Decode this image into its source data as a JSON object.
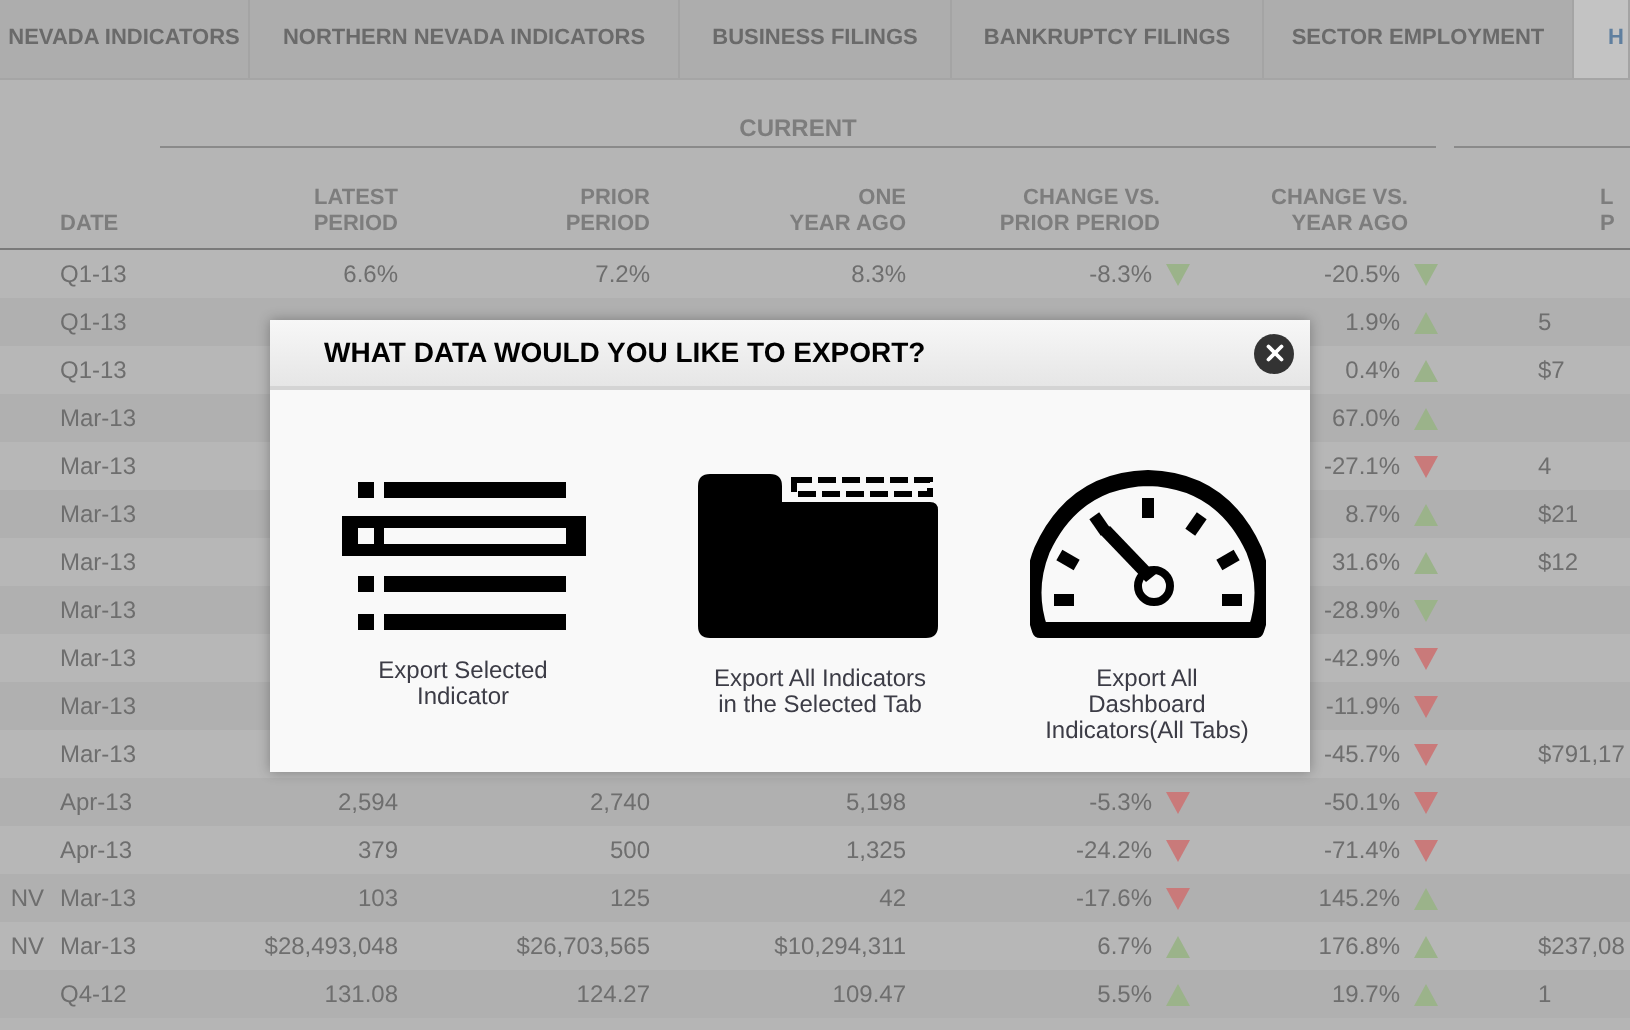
{
  "tabs": [
    {
      "label": "NEVADA INDICATORS",
      "selected": false
    },
    {
      "label": "NORTHERN NEVADA INDICATORS",
      "selected": false
    },
    {
      "label": "BUSINESS FILINGS",
      "selected": false
    },
    {
      "label": "BANKRUPTCY FILINGS",
      "selected": false
    },
    {
      "label": "SECTOR EMPLOYMENT",
      "selected": false
    },
    {
      "label": "H",
      "selected": true
    }
  ],
  "group_header": {
    "label": "CURRENT"
  },
  "columns": {
    "date": [
      "DATE"
    ],
    "latest": [
      "LATEST",
      "PERIOD"
    ],
    "prior": [
      "PRIOR",
      "PERIOD"
    ],
    "one_year_ago": [
      "ONE",
      "YEAR AGO"
    ],
    "change_vs_prior": [
      "CHANGE VS.",
      "PRIOR PERIOD"
    ],
    "change_vs_year": [
      "CHANGE VS.",
      "YEAR AGO"
    ],
    "column_8": [
      "L",
      "P"
    ]
  },
  "rows": [
    {
      "date": "Q1-13",
      "latest": "6.6%",
      "prior": "7.2%",
      "one_year_ago": "8.3%",
      "change_vs_prior": {
        "value": "-8.3%",
        "rising": false,
        "color": "#9bb38a"
      },
      "change_vs_year": {
        "value": "-20.5%",
        "rising": false,
        "color": "#9bb38a"
      }
    },
    {
      "date": "Q1-13",
      "change_vs_year": {
        "value": "1.9%",
        "rising": true,
        "color": "#9bb38a"
      },
      "column_8": "5"
    },
    {
      "date": "Q1-13",
      "change_vs_year": {
        "value": "0.4%",
        "rising": true,
        "color": "#9bb38a"
      },
      "column_8": "$7"
    },
    {
      "date": "Mar-13",
      "change_vs_year": {
        "value": "67.0%",
        "rising": true,
        "color": "#9bb38a"
      }
    },
    {
      "date": "Mar-13",
      "change_vs_year": {
        "value": "-27.1%",
        "rising": false,
        "color": "#c97a7a"
      },
      "column_8": "4"
    },
    {
      "date": "Mar-13",
      "change_vs_year": {
        "value": "8.7%",
        "rising": true,
        "color": "#9bb38a"
      },
      "column_8": "$21"
    },
    {
      "date": "Mar-13",
      "change_vs_year": {
        "value": "31.6%",
        "rising": true,
        "color": "#9bb38a"
      },
      "column_8": "$12"
    },
    {
      "date": "Mar-13",
      "change_vs_year": {
        "value": "-28.9%",
        "rising": false,
        "color": "#9bb38a"
      }
    },
    {
      "date": "Mar-13",
      "change_vs_year": {
        "value": "-42.9%",
        "rising": false,
        "color": "#c97a7a"
      }
    },
    {
      "date": "Mar-13",
      "change_vs_year": {
        "value": "-11.9%",
        "rising": false,
        "color": "#c97a7a"
      }
    },
    {
      "date": "Mar-13",
      "change_vs_year": {
        "value": "-45.7%",
        "rising": false,
        "color": "#c97a7a"
      },
      "column_8": "$791,17"
    },
    {
      "date": "Apr-13",
      "latest": "2,594",
      "prior": "2,740",
      "one_year_ago": "5,198",
      "change_vs_prior": {
        "value": "-5.3%",
        "rising": false,
        "color": "#c97a7a"
      },
      "change_vs_year": {
        "value": "-50.1%",
        "rising": false,
        "color": "#c97a7a"
      }
    },
    {
      "date": "Apr-13",
      "latest": "379",
      "prior": "500",
      "one_year_ago": "1,325",
      "change_vs_prior": {
        "value": "-24.2%",
        "rising": false,
        "color": "#c97a7a"
      },
      "change_vs_year": {
        "value": "-71.4%",
        "rising": false,
        "color": "#c97a7a"
      }
    },
    {
      "region": "NV",
      "date": "Mar-13",
      "latest": "103",
      "prior": "125",
      "one_year_ago": "42",
      "change_vs_prior": {
        "value": "-17.6%",
        "rising": false,
        "color": "#c97a7a"
      },
      "change_vs_year": {
        "value": "145.2%",
        "rising": true,
        "color": "#9bb38a"
      }
    },
    {
      "region": "NV",
      "date": "Mar-13",
      "latest": "$28,493,048",
      "prior": "$26,703,565",
      "one_year_ago": "$10,294,311",
      "change_vs_prior": {
        "value": "6.7%",
        "rising": true,
        "color": "#9bb38a"
      },
      "change_vs_year": {
        "value": "176.8%",
        "rising": true,
        "color": "#9bb38a"
      },
      "column_8": "$237,08"
    },
    {
      "date": "Q4-12",
      "latest": "131.08",
      "prior": "124.27",
      "one_year_ago": "109.47",
      "change_vs_prior": {
        "value": "5.5%",
        "rising": true,
        "color": "#9bb38a"
      },
      "change_vs_year": {
        "value": "19.7%",
        "rising": true,
        "color": "#9bb38a"
      },
      "column_8": "1"
    }
  ],
  "dialog": {
    "title": "WHAT DATA WOULD YOU LIKE TO EXPORT?",
    "options": [
      {
        "kind": "list",
        "label_lines": [
          "Export Selected",
          "Indicator"
        ]
      },
      {
        "kind": "folder",
        "label_lines": [
          "Export All Indicators",
          "in the Selected Tab"
        ]
      },
      {
        "kind": "gauge",
        "label_lines": [
          "Export All",
          "Dashboard",
          "Indicators(All Tabs)"
        ]
      }
    ]
  }
}
